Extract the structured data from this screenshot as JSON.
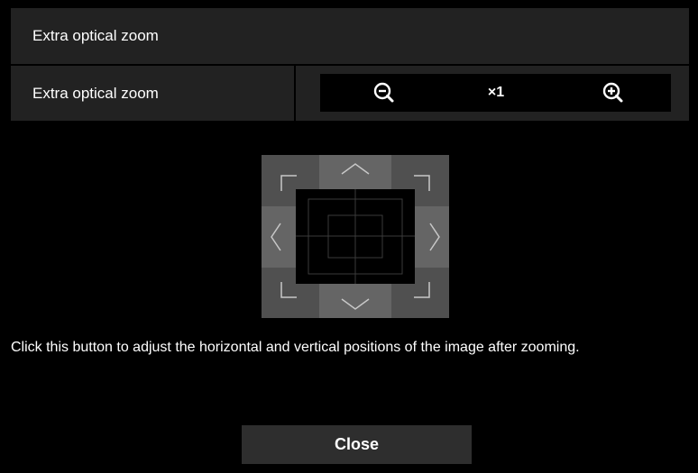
{
  "panel": {
    "title": "Extra optical zoom"
  },
  "zoom": {
    "label": "Extra optical zoom",
    "value": "×1",
    "zoom_out_icon": "magnifier-minus-icon",
    "zoom_in_icon": "magnifier-plus-icon"
  },
  "position_pad": {
    "buttons": [
      "up-left",
      "up",
      "up-right",
      "left",
      "right",
      "down-left",
      "down",
      "down-right"
    ]
  },
  "help_text": "Click this button to adjust the horizontal and vertical positions of the image after zooming.",
  "close_label": "Close",
  "colors": {
    "background": "#000000",
    "panel": "#222222",
    "pad_corner": "#505050",
    "pad_arrow": "#656565",
    "close_button": "#2e2e2e"
  }
}
